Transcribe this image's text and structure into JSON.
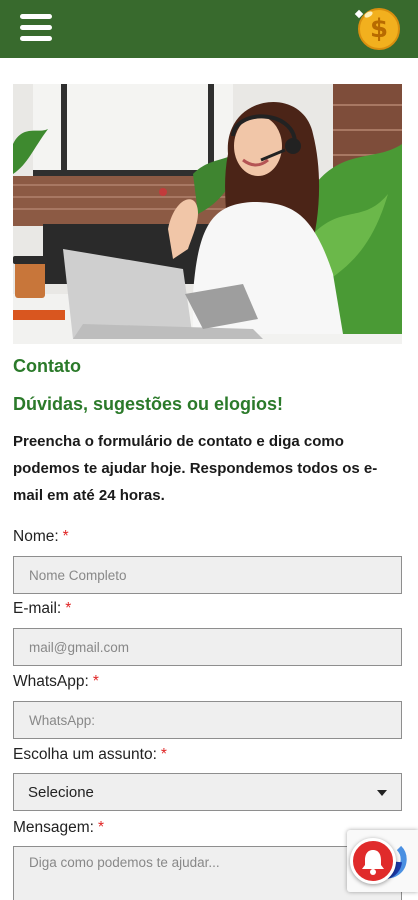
{
  "header": {
    "menu_icon": "hamburger-menu-icon",
    "coin_icon": "dollar-coin-icon",
    "coin_symbol": "$",
    "brand_color": "#386a2d"
  },
  "hero": {
    "image": "woman-with-headset-at-laptop"
  },
  "content": {
    "title": "Contato",
    "subtitle": "Dúvidas, sugestões ou elogios!",
    "intro": "Preencha o formulário de contato e diga como podemos te ajudar hoje.  Respondemos todos os e-mail em até 24 horas."
  },
  "form": {
    "required_mark": "*",
    "name": {
      "label": "Nome:",
      "placeholder": "Nome Completo",
      "value": ""
    },
    "email": {
      "label": "E-mail:",
      "placeholder": "mail@gmail.com",
      "value": ""
    },
    "whatsapp": {
      "label": "WhatsApp:",
      "placeholder": "WhatsApp:",
      "value": ""
    },
    "subject": {
      "label": "Escolha um assunto:",
      "selected": "Selecione"
    },
    "message": {
      "label": "Mensagem:",
      "placeholder": "Diga como podemos te ajudar..."
    }
  },
  "widgets": {
    "notification_icon": "bell-icon",
    "recaptcha_icon": "recaptcha-icon",
    "accent_red": "#e02b2b"
  }
}
